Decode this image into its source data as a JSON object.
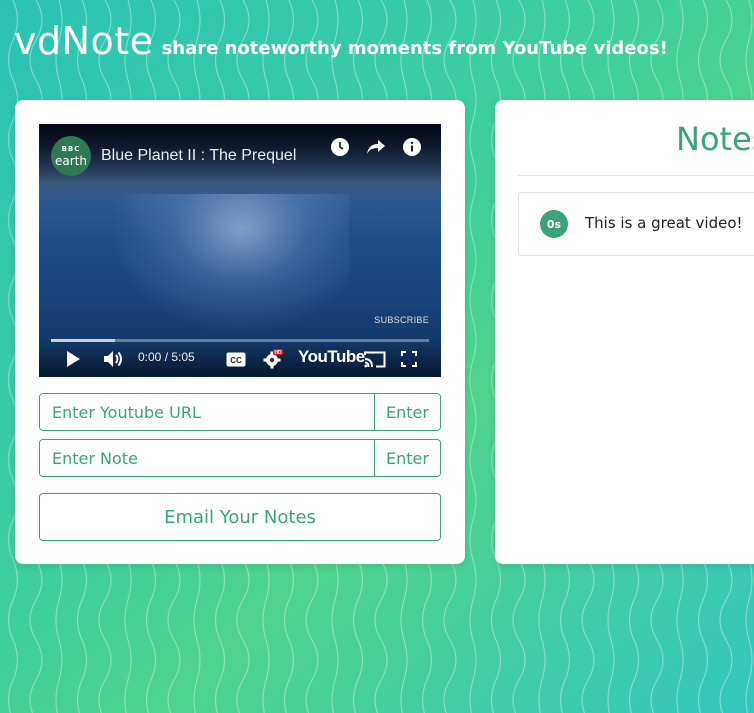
{
  "header": {
    "logo": "vdNote",
    "tagline": "share noteworthy moments from YouTube videos!"
  },
  "player": {
    "channel_badge_top": "BBC",
    "channel_badge_bottom": "earth",
    "title": "Blue Planet II : The Prequel",
    "subscribe_label": "SUBSCRIBE",
    "time": "0:00 / 5:05",
    "brand": "YouTube",
    "progress": 0.17
  },
  "inputs": {
    "url_placeholder": "Enter Youtube URL",
    "url_button": "Enter",
    "note_placeholder": "Enter Note",
    "note_button": "Enter"
  },
  "email_button": "Email Your Notes",
  "notes": {
    "title": "Notes",
    "items": [
      {
        "time": "0s",
        "text": "This is a great video!"
      }
    ]
  },
  "colors": {
    "accent": "#3aa37a",
    "background_start": "#2cc3b6",
    "background_end": "#4fd48d"
  }
}
